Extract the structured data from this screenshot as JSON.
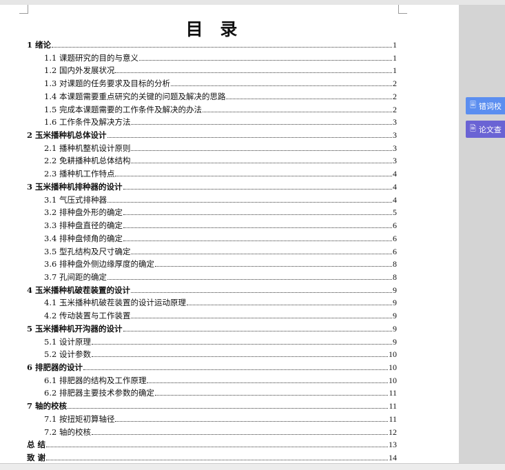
{
  "toc": {
    "title": "目 录",
    "entries": [
      {
        "level": 1,
        "label": "1 绪论",
        "page": "1"
      },
      {
        "level": 2,
        "label": "1.1 课题研究的目的与意义",
        "page": "1"
      },
      {
        "level": 2,
        "label": "1.2 国内外发展状况",
        "page": "1"
      },
      {
        "level": 2,
        "label": "1.3 对课题的任务要求及目标的分析",
        "page": "2"
      },
      {
        "level": 2,
        "label": "1.4 本课题需要重点研究的关键的问题及解决的思路",
        "page": "2"
      },
      {
        "level": 2,
        "label": "1.5 完成本课题需要的工作条件及解决的办法",
        "page": "2"
      },
      {
        "level": 2,
        "label": "1.6 工作条件及解决方法",
        "page": "3"
      },
      {
        "level": 1,
        "label": "2 玉米播种机总体设计",
        "page": "3"
      },
      {
        "level": 2,
        "label": "2.1 播种机整机设计原则",
        "page": "3"
      },
      {
        "level": 2,
        "label": "2.2 免耕播种机总体结构",
        "page": "3"
      },
      {
        "level": 2,
        "label": "2.3 播种机工作特点",
        "page": "4"
      },
      {
        "level": 1,
        "label": "3 玉米播种机排种器的设计",
        "page": "4"
      },
      {
        "level": 2,
        "label": "3.1 气压式排种器",
        "page": "4"
      },
      {
        "level": 2,
        "label": "3.2 排种盘外形的确定",
        "page": "5"
      },
      {
        "level": 2,
        "label": "3.3 排种盘直径的确定",
        "page": "6"
      },
      {
        "level": 2,
        "label": "3.4 排种盘倾角的确定",
        "page": "6"
      },
      {
        "level": 2,
        "label": "3.5 型孔结构及尺寸确定",
        "page": "6"
      },
      {
        "level": 2,
        "label": "3.6 排种盘外侧边缘厚度的确定",
        "page": "8"
      },
      {
        "level": 2,
        "label": "3.7 孔间距的确定",
        "page": "8"
      },
      {
        "level": 1,
        "label": "4 玉米播种机破茬装置的设计",
        "page": "9"
      },
      {
        "level": 2,
        "label": "4.1 玉米播种机破茬装置的设计运动原理",
        "page": "9"
      },
      {
        "level": 2,
        "label": "4.2 传动装置与工作装置",
        "page": "9"
      },
      {
        "level": 1,
        "label": "5 玉米播种机开沟器的设计",
        "page": "9"
      },
      {
        "level": 2,
        "label": "5.1 设计原理",
        "page": "9"
      },
      {
        "level": 2,
        "label": "5.2 设计参数",
        "page": "10"
      },
      {
        "level": 1,
        "label": "6 排肥器的设计",
        "page": "10"
      },
      {
        "level": 2,
        "label": "6.1  排肥器的结构及工作原理",
        "page": "10"
      },
      {
        "level": 2,
        "label": "6.2 排肥器主要技术参数的确定",
        "page": "11"
      },
      {
        "level": 1,
        "label": "7 轴的校核",
        "page": "11"
      },
      {
        "level": 2,
        "label": "7.1 按扭矩初算轴径",
        "page": "11"
      },
      {
        "level": 2,
        "label": "7.2 轴的校核",
        "page": "12"
      },
      {
        "level": 1,
        "label": "总  结",
        "page": "13"
      },
      {
        "level": 1,
        "label": "致  谢",
        "page": "14"
      }
    ]
  },
  "side_panel": {
    "proofread_label": "错词校",
    "check_label": "论文查"
  },
  "colors": {
    "proofread": "#5b8ef0",
    "check": "#6a63d4"
  }
}
